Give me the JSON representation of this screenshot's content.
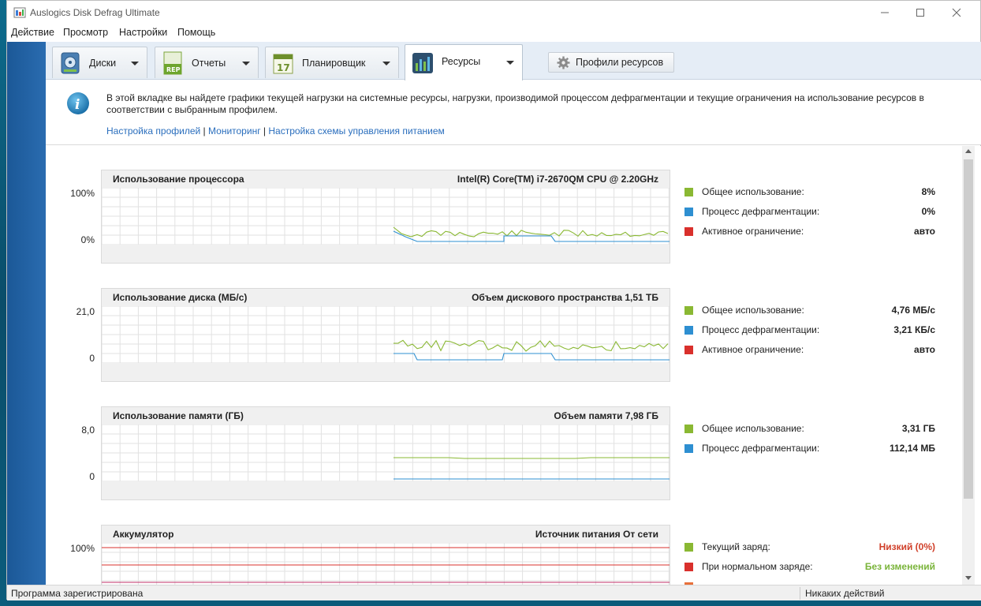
{
  "window": {
    "title": "Auslogics Disk Defrag Ultimate"
  },
  "menu": [
    "Действие",
    "Просмотр",
    "Настройки",
    "Помощь"
  ],
  "tabs": [
    {
      "label": "Диски",
      "icon": "disk-icon",
      "active": false
    },
    {
      "label": "Отчеты",
      "icon": "report-icon",
      "active": false
    },
    {
      "label": "Планировщик",
      "icon": "calendar-icon",
      "active": false
    },
    {
      "label": "Ресурсы",
      "icon": "resources-chart-icon",
      "active": true
    }
  ],
  "profiles_button": {
    "label": "Профили ресурсов",
    "icon": "gear-icon"
  },
  "info": {
    "text": "В этой вкладке вы найдете графики текущей нагрузки на системные ресурсы, нагрузки, производимой процессом дефрагментации и текущие ограничения на использование ресурсов в соответствии с выбранным профилем.",
    "links": [
      "Настройка профилей",
      "Мониторинг",
      "Настройка схемы управления питанием"
    ],
    "separator": " | "
  },
  "colors": {
    "green": "#8ab833",
    "blue": "#2e8fd1",
    "red": "#d9302c",
    "orange": "#e8703a",
    "status_red": "#d0402a",
    "status_green": "#7ab43a"
  },
  "panels": [
    {
      "title": "Использование процессора",
      "subtitle": "Intel(R) Core(TM) i7-2670QM CPU @ 2.20GHz",
      "ymax_label": "100%",
      "ymin_label": "0%",
      "legend": [
        {
          "color": "green",
          "label": "Общее использование:",
          "value": "8%"
        },
        {
          "color": "blue",
          "label": "Процесс дефрагментации:",
          "value": "0%"
        },
        {
          "color": "red",
          "label": "Активное ограничение:",
          "value": "авто"
        }
      ]
    },
    {
      "title": "Использование диска (МБ/с)",
      "subtitle": "Объем дискового пространства 1,51 ТБ",
      "ymax_label": "21,0",
      "ymin_label": "0",
      "legend": [
        {
          "color": "green",
          "label": "Общее использование:",
          "value": "4,76 МБ/с"
        },
        {
          "color": "blue",
          "label": "Процесс дефрагментации:",
          "value": "3,21 КБ/с"
        },
        {
          "color": "red",
          "label": "Активное ограничение:",
          "value": "авто"
        }
      ]
    },
    {
      "title": "Использование памяти (ГБ)",
      "subtitle": "Объем памяти 7,98 ГБ",
      "ymax_label": "8,0",
      "ymin_label": "0",
      "legend": [
        {
          "color": "green",
          "label": "Общее использование:",
          "value": "3,31 ГБ"
        },
        {
          "color": "blue",
          "label": "Процесс дефрагментации:",
          "value": "112,14 МБ"
        }
      ]
    },
    {
      "title": "Аккумулятор",
      "subtitle": "Источник питания От сети",
      "ymax_label": "100%",
      "ymin_label": "",
      "legend": [
        {
          "color": "green",
          "label": "Текущий заряд:",
          "value": "Низкий (0%)",
          "value_color": "status_red"
        },
        {
          "color": "red",
          "label": "При нормальном заряде:",
          "value": "Без изменений",
          "value_color": "status_green"
        },
        {
          "color": "orange",
          "label": "",
          "value": ""
        }
      ]
    }
  ],
  "status": {
    "left": "Программа зарегистрирована",
    "right": "Никаких действий"
  }
}
